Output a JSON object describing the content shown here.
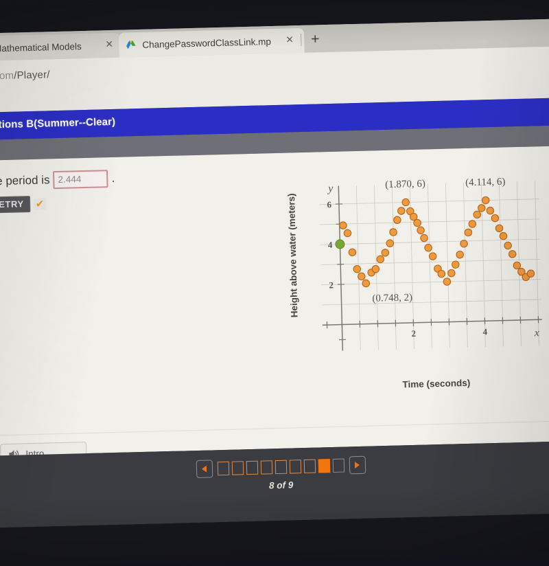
{
  "browser": {
    "tabs": [
      {
        "title": "CA Mathematical Models",
        "close_label": "✕",
        "icon": "none"
      },
      {
        "title": "ChangePasswordClassLink.mp",
        "close_label": "✕",
        "icon": "google-drive-icon"
      }
    ],
    "new_tab_label": "+",
    "url": "ity.com/Player/",
    "url_dim": "ity.com",
    "url_rest": "/Player/"
  },
  "app": {
    "header_title": "lications B(Summer--Clear)",
    "header_color": "#2b2ec4"
  },
  "question": {
    "prompt_before": "The period is",
    "prompt_after": ".",
    "answer_value": "2.444",
    "answer_placeholder": "",
    "retry_label": "RETRY",
    "check_mark": "✔",
    "answer_border_color": "#cd8f93",
    "check_color": "#eb9b2d"
  },
  "audio": {
    "intro_label": "Intro",
    "speaker_icon": "speaker-icon"
  },
  "bottom_nav": {
    "prev_icon": "triangle-left-icon",
    "next_icon": "triangle-right-icon",
    "counter": "8 of 9",
    "total_pages": 9,
    "current_page": 8,
    "boxes": [
      "done",
      "done",
      "done",
      "done",
      "done",
      "done",
      "done",
      "current",
      "future"
    ],
    "accent_color": "#f4740d",
    "bar_color": "#3b3c41"
  },
  "chart_data": {
    "type": "scatter",
    "title": "",
    "xlabel": "Time (seconds)",
    "ylabel": "Height above water (meters)",
    "x_axis_symbol": "x",
    "y_axis_symbol": "y",
    "xlim": [
      -0.55,
      5.6
    ],
    "ylim": [
      -1.3,
      6.9
    ],
    "xticks": [
      0,
      0.5,
      1,
      1.5,
      2,
      2.5,
      3,
      3.5,
      4,
      4.5,
      5,
      5.5
    ],
    "xtick_labels": [
      "",
      "",
      "",
      "",
      "2",
      "",
      "",
      "",
      "4",
      "",
      "",
      ""
    ],
    "yticks": [
      2,
      3,
      4,
      5,
      6
    ],
    "ytick_labels": [
      "2",
      "",
      "4",
      "",
      "6"
    ],
    "grid": true,
    "grid_color": "#c7c4bb",
    "point_color": "#ef9a3d",
    "point_edge_color": "#b9651a",
    "highlight_point_color": "#76a832",
    "highlight_point": {
      "x": 0,
      "y": 4.0
    },
    "annotations": [
      {
        "text": "(1.870, 6)",
        "x": 1.87,
        "y": 6.0,
        "placement": "above"
      },
      {
        "text": "(4.114, 6)",
        "x": 4.114,
        "y": 6.0,
        "placement": "above"
      },
      {
        "text": "(0.748, 2)",
        "x": 0.748,
        "y": 2.0,
        "placement": "below-right"
      }
    ],
    "series": [
      {
        "name": "Height above water",
        "points": [
          [
            0.0,
            4.0
          ],
          [
            0.1,
            4.93
          ],
          [
            0.22,
            4.54
          ],
          [
            0.34,
            3.58
          ],
          [
            0.46,
            2.74
          ],
          [
            0.58,
            2.37
          ],
          [
            0.7,
            2.02
          ],
          [
            0.86,
            2.55
          ],
          [
            0.98,
            2.72
          ],
          [
            1.12,
            3.2
          ],
          [
            1.26,
            3.52
          ],
          [
            1.4,
            3.98
          ],
          [
            1.5,
            4.53
          ],
          [
            1.62,
            5.13
          ],
          [
            1.74,
            5.58
          ],
          [
            1.87,
            6.0
          ],
          [
            1.99,
            5.55
          ],
          [
            2.08,
            5.27
          ],
          [
            2.18,
            4.96
          ],
          [
            2.27,
            4.59
          ],
          [
            2.36,
            4.2
          ],
          [
            2.47,
            3.71
          ],
          [
            2.59,
            3.28
          ],
          [
            2.72,
            2.66
          ],
          [
            2.82,
            2.4
          ],
          [
            2.97,
            2.0
          ],
          [
            3.1,
            2.42
          ],
          [
            3.22,
            2.84
          ],
          [
            3.35,
            3.33
          ],
          [
            3.47,
            3.87
          ],
          [
            3.6,
            4.42
          ],
          [
            3.72,
            4.84
          ],
          [
            3.86,
            5.3
          ],
          [
            3.99,
            5.62
          ],
          [
            4.11,
            6.0
          ],
          [
            4.23,
            5.48
          ],
          [
            4.36,
            5.1
          ],
          [
            4.47,
            4.59
          ],
          [
            4.58,
            4.2
          ],
          [
            4.7,
            3.72
          ],
          [
            4.82,
            3.29
          ],
          [
            4.94,
            2.72
          ],
          [
            5.06,
            2.4
          ],
          [
            5.18,
            2.13
          ],
          [
            5.32,
            2.3
          ]
        ]
      }
    ]
  }
}
